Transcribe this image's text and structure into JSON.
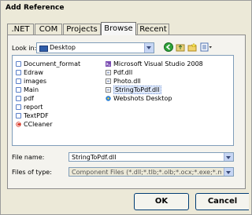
{
  "window": {
    "title": "Add Reference"
  },
  "tabs": [
    {
      "label": ".NET"
    },
    {
      "label": "COM"
    },
    {
      "label": "Projects"
    },
    {
      "label": "Browse"
    },
    {
      "label": "Recent"
    }
  ],
  "active_tab": "Browse",
  "lookin": {
    "label": "Look in:",
    "value": "Desktop"
  },
  "files": {
    "column1": [
      {
        "name": "Document_format",
        "type": "folder"
      },
      {
        "name": "Edraw",
        "type": "folder"
      },
      {
        "name": "images",
        "type": "folder"
      },
      {
        "name": "Main",
        "type": "folder"
      },
      {
        "name": "pdf",
        "type": "folder"
      },
      {
        "name": "report",
        "type": "folder"
      },
      {
        "name": "TextPDF",
        "type": "folder"
      },
      {
        "name": "CCleaner",
        "type": "app"
      }
    ],
    "column2": [
      {
        "name": "Microsoft Visual Studio 2008",
        "type": "app"
      },
      {
        "name": "Pdf.dll",
        "type": "dll"
      },
      {
        "name": "Photo.dll",
        "type": "dll"
      },
      {
        "name": "StringToPdf.dll",
        "type": "dll",
        "selected": true
      },
      {
        "name": "Webshots Desktop",
        "type": "app"
      }
    ]
  },
  "file_name": {
    "label": "File name:",
    "value": "StringToPdf.dll"
  },
  "file_type": {
    "label": "Files of type:",
    "value": "Component Files (*.dll;*.tlb;*.olb;*.ocx;*.exe;*.manifest)"
  },
  "buttons": {
    "ok": "OK",
    "cancel": "Cancel"
  }
}
